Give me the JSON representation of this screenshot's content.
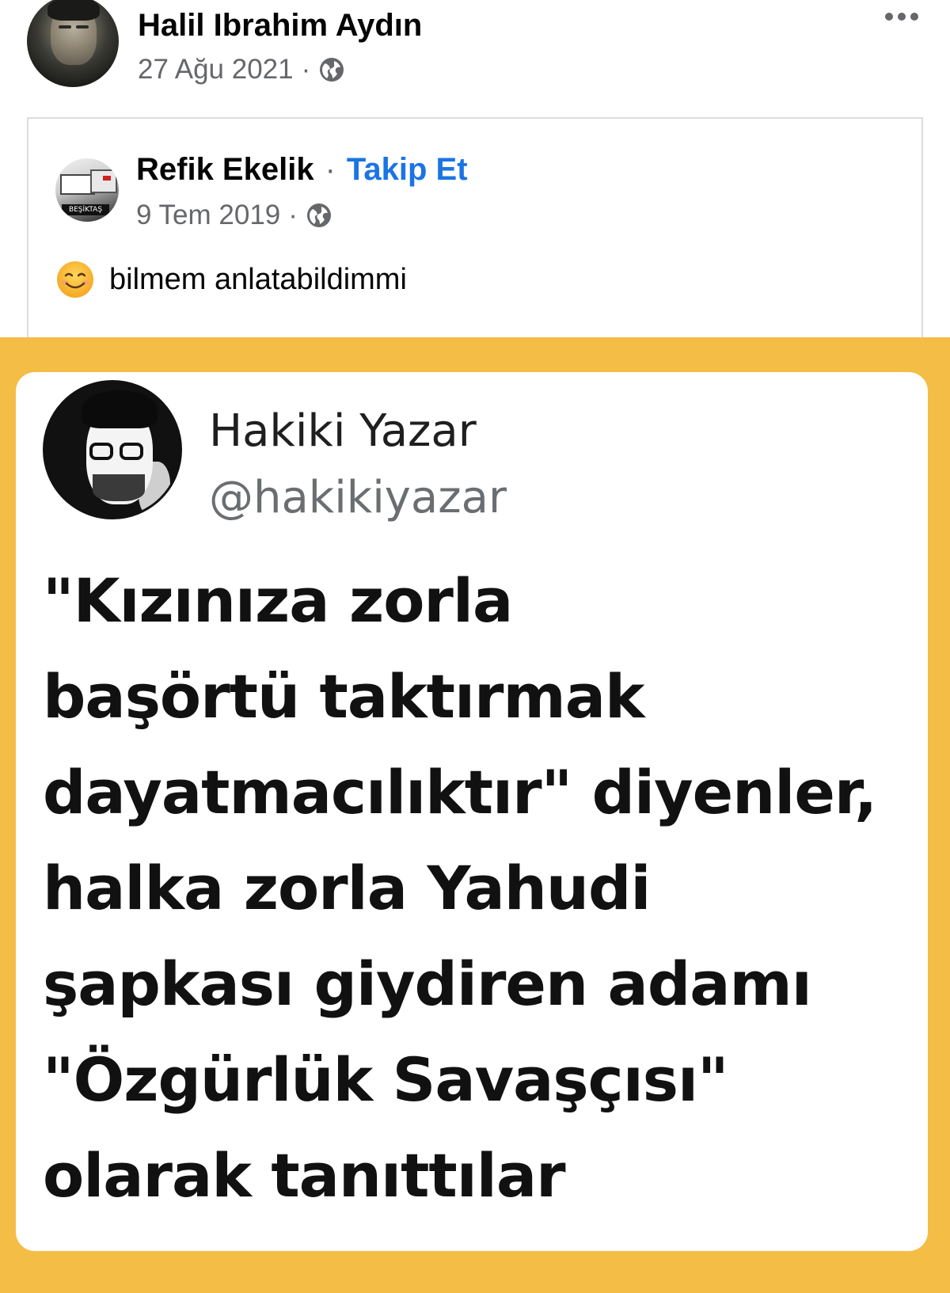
{
  "post": {
    "author": "Halil Ibrahim Aydın",
    "date": "27 Ağu 2021",
    "meta_sep": "·",
    "privacy_icon": "globe-icon",
    "more_icon": "more-options-icon"
  },
  "shared": {
    "author": "Refik Ekelik",
    "sep": "·",
    "follow_label": "Takip Et",
    "date": "9 Tem 2019",
    "meta_sep": "·",
    "privacy_icon": "globe-icon",
    "avatar_text": "BEŞİKTAŞ",
    "emoji": "smiling-face-icon",
    "text": "bilmem anlatabildimmi"
  },
  "image": {
    "background_color": "#f4bd45",
    "tweet": {
      "name": "Hakiki Yazar",
      "handle": "@hakikiyazar",
      "lines": [
        "\"Kızınıza zorla",
        "başörtü taktırmak",
        "dayatmacılıktır\" diyenler,",
        "halka zorla Yahudi",
        "şapkası giydiren adamı",
        "\"Özgürlük Savaşçısı\"",
        "olarak tanıttılar"
      ]
    }
  },
  "colors": {
    "link": "#1b74e4",
    "secondary_text": "#65676b",
    "primary_text": "#050505"
  }
}
